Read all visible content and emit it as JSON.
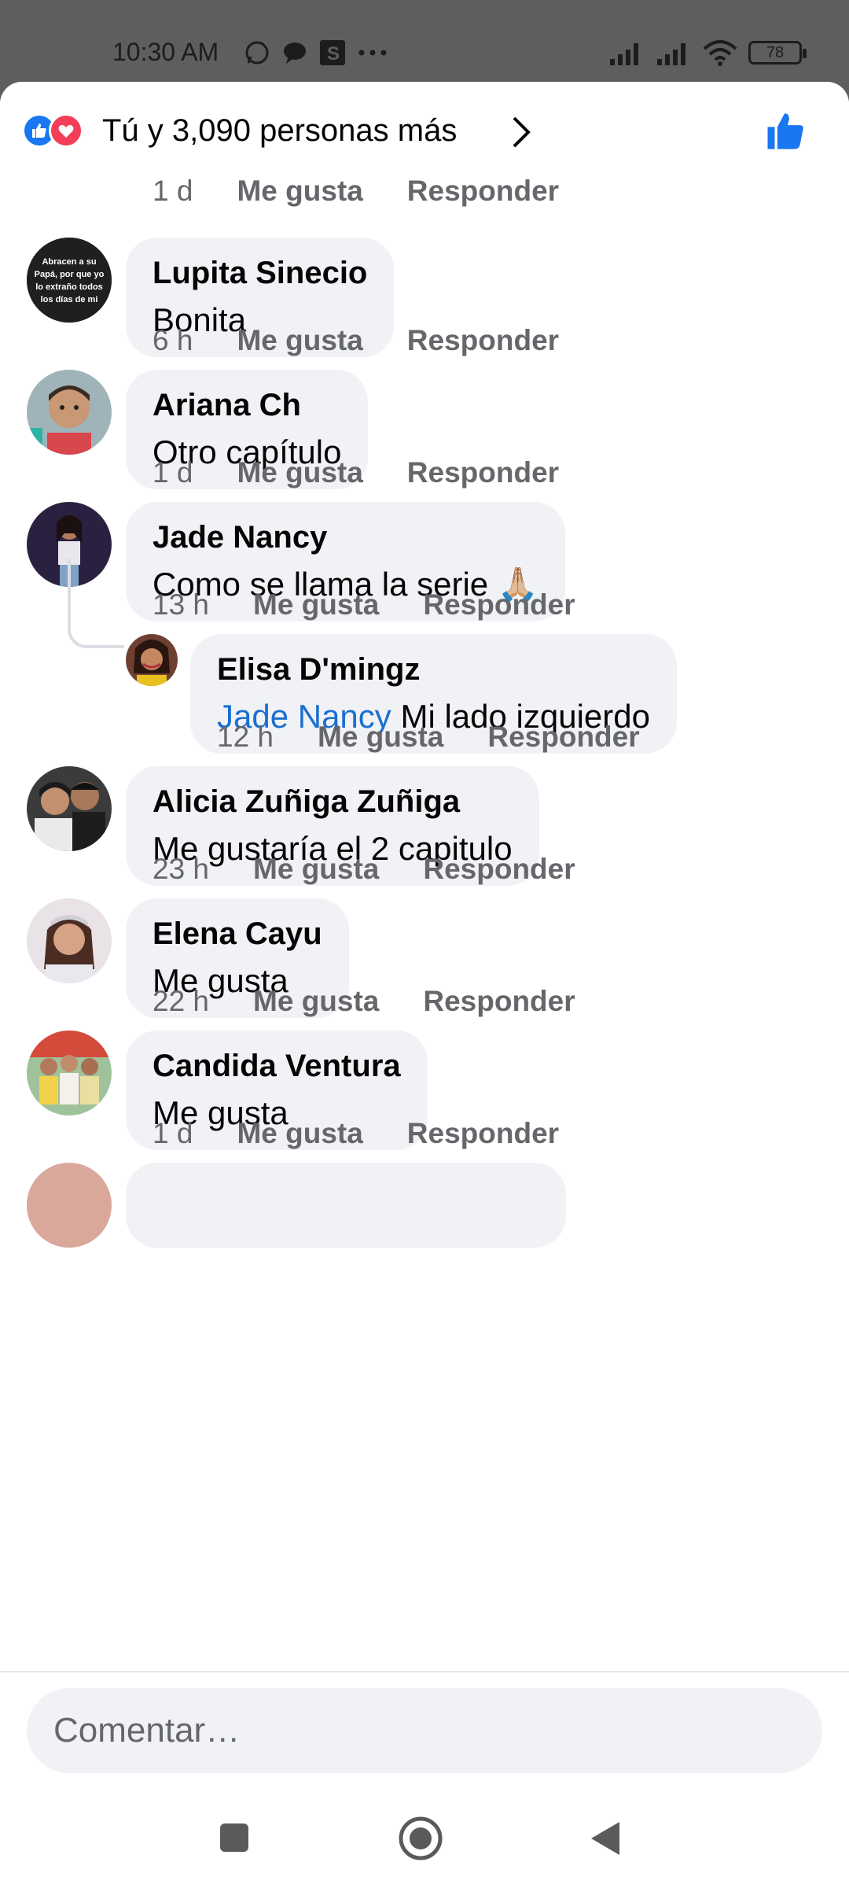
{
  "status_bar": {
    "time": "10:30 AM",
    "left_icons": [
      "whatsapp-icon",
      "message-bubble-icon",
      "s-app-icon",
      "more-dots-icon"
    ],
    "right_icons": [
      "signal-icon",
      "signal-icon",
      "wifi-icon",
      "battery-icon"
    ],
    "battery": "78"
  },
  "header": {
    "reactions_text": "Tú y 3,090 personas más",
    "reaction_icons": [
      "like-icon",
      "love-icon"
    ],
    "colors": {
      "like": "#1a77f2",
      "love": "#f33e58"
    }
  },
  "partial_top_meta": {
    "time": "1 d",
    "like": "Me gusta",
    "reply": "Responder"
  },
  "comments": [
    {
      "name": "Lupita Sinecio",
      "text": "Bonita",
      "time": "6 h",
      "like": "Me gusta",
      "reply": "Responder",
      "avatar_text": "Abracen a su Papá, por que yo lo extraño todos los días de mi"
    },
    {
      "name": "Ariana Ch",
      "text": "Otro capítulo",
      "time": "1 d",
      "like": "Me gusta",
      "reply": "Responder"
    },
    {
      "name": "Jade Nancy",
      "text": "Como se llama la serie 🙏🏼",
      "time": "13 h",
      "like": "Me gusta",
      "reply": "Responder"
    },
    {
      "name": "Alicia Zuñiga Zuñiga",
      "text": "Me gustaría  el 2 capitulo",
      "time": "23 h",
      "like": "Me gusta",
      "reply": "Responder"
    },
    {
      "name": "Elena Cayu",
      "text": "Me gusta",
      "time": "22 h",
      "like": "Me gusta",
      "reply": "Responder"
    },
    {
      "name": "Candida Ventura",
      "text": "Me gusta",
      "time": "1 d",
      "like": "Me gusta",
      "reply": "Responder"
    }
  ],
  "reply": {
    "name": "Elisa D'mingz",
    "mention": "Jade Nancy",
    "text": "Mi lado izquierdo",
    "time": "12 h",
    "like": "Me gusta",
    "reply": "Responder"
  },
  "composer": {
    "placeholder": "Comentar…"
  },
  "nav": {
    "icons": [
      "recents-square-icon",
      "home-circle-icon",
      "back-triangle-icon"
    ]
  }
}
